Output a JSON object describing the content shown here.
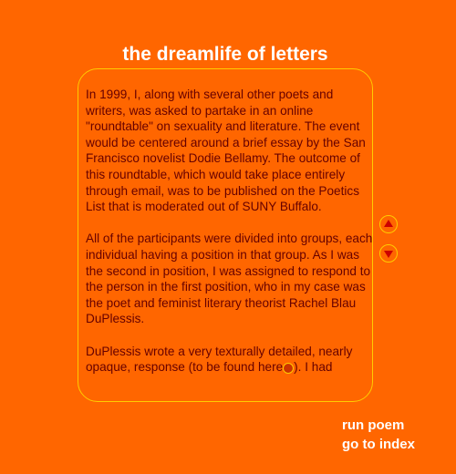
{
  "page": {
    "title": "the dreamlife of letters"
  },
  "text": {
    "paragraphs": [
      "In 1999, I, along with several other poets and writers, was asked to partake in an online \"roundtable\" on sexuality and literature.  The event would be centered around a brief essay by the San Francisco novelist Dodie Bellamy.  The outcome of this roundtable, which would take place entirely through email, was to be published on the Poetics List that is moderated out of SUNY Buffalo.",
      "All of the participants were divided into groups, each individual having a position in that group. As I was the second in position, I was assigned to respond to the person in the first position, who in my case was the poet and feminist literary theorist Rachel Blau DuPlessis."
    ],
    "para3_before": "DuPlessis wrote a very texturally detailed, nearly opaque, response (to be found here",
    "para3_after": ").  I had"
  },
  "scroll": {
    "up_icon": "triangle-up-icon",
    "down_icon": "triangle-down-icon"
  },
  "nav": {
    "run_poem": "run poem",
    "go_to_index": "go to index"
  },
  "colors": {
    "background": "#ff6600",
    "text": "#660000",
    "border": "#ffcc00",
    "arrow": "#cc0000",
    "title": "#ffffff"
  }
}
